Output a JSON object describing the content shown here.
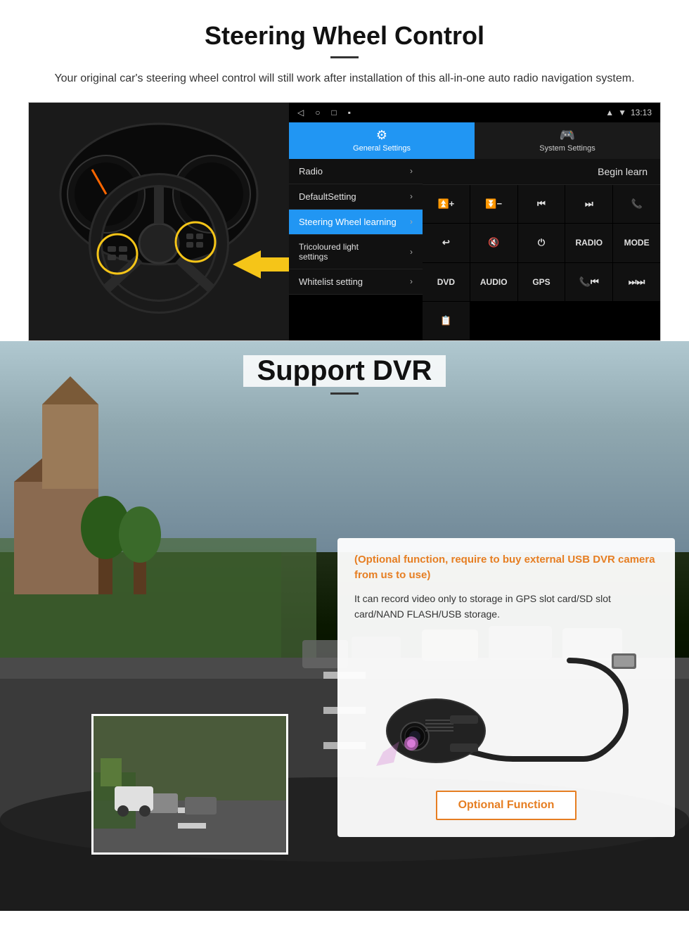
{
  "section1": {
    "title": "Steering Wheel Control",
    "subtitle": "Your original car's steering wheel control will still work after installation of this all-in-one auto radio navigation system.",
    "statusbar": {
      "time": "13:13",
      "nav_icons": [
        "◁",
        "○",
        "□",
        "▪"
      ]
    },
    "tabs": [
      {
        "label": "General Settings",
        "icon": "⚙",
        "active": true
      },
      {
        "label": "System Settings",
        "icon": "🎮",
        "active": false
      }
    ],
    "menu_items": [
      {
        "label": "Radio",
        "active": false
      },
      {
        "label": "DefaultSetting",
        "active": false
      },
      {
        "label": "Steering Wheel learning",
        "active": true
      },
      {
        "label": "Tricoloured light settings",
        "active": false
      },
      {
        "label": "Whitelist setting",
        "active": false
      }
    ],
    "begin_learn_label": "Begin learn",
    "control_buttons": [
      "🔊+",
      "🔊−",
      "⏮",
      "⏭",
      "📞",
      "↩",
      "🔇",
      "⏻",
      "RADIO",
      "MODE",
      "DVD",
      "AUDIO",
      "GPS",
      "📞⏮",
      "⏭⏭"
    ],
    "extra_icon": "📋"
  },
  "section2": {
    "title": "Support DVR",
    "optional_text": "(Optional function, require to buy external USB DVR camera from us to use)",
    "description": "It can record video only to storage in GPS slot card/SD slot card/NAND FLASH/USB storage.",
    "optional_function_btn": "Optional Function"
  }
}
